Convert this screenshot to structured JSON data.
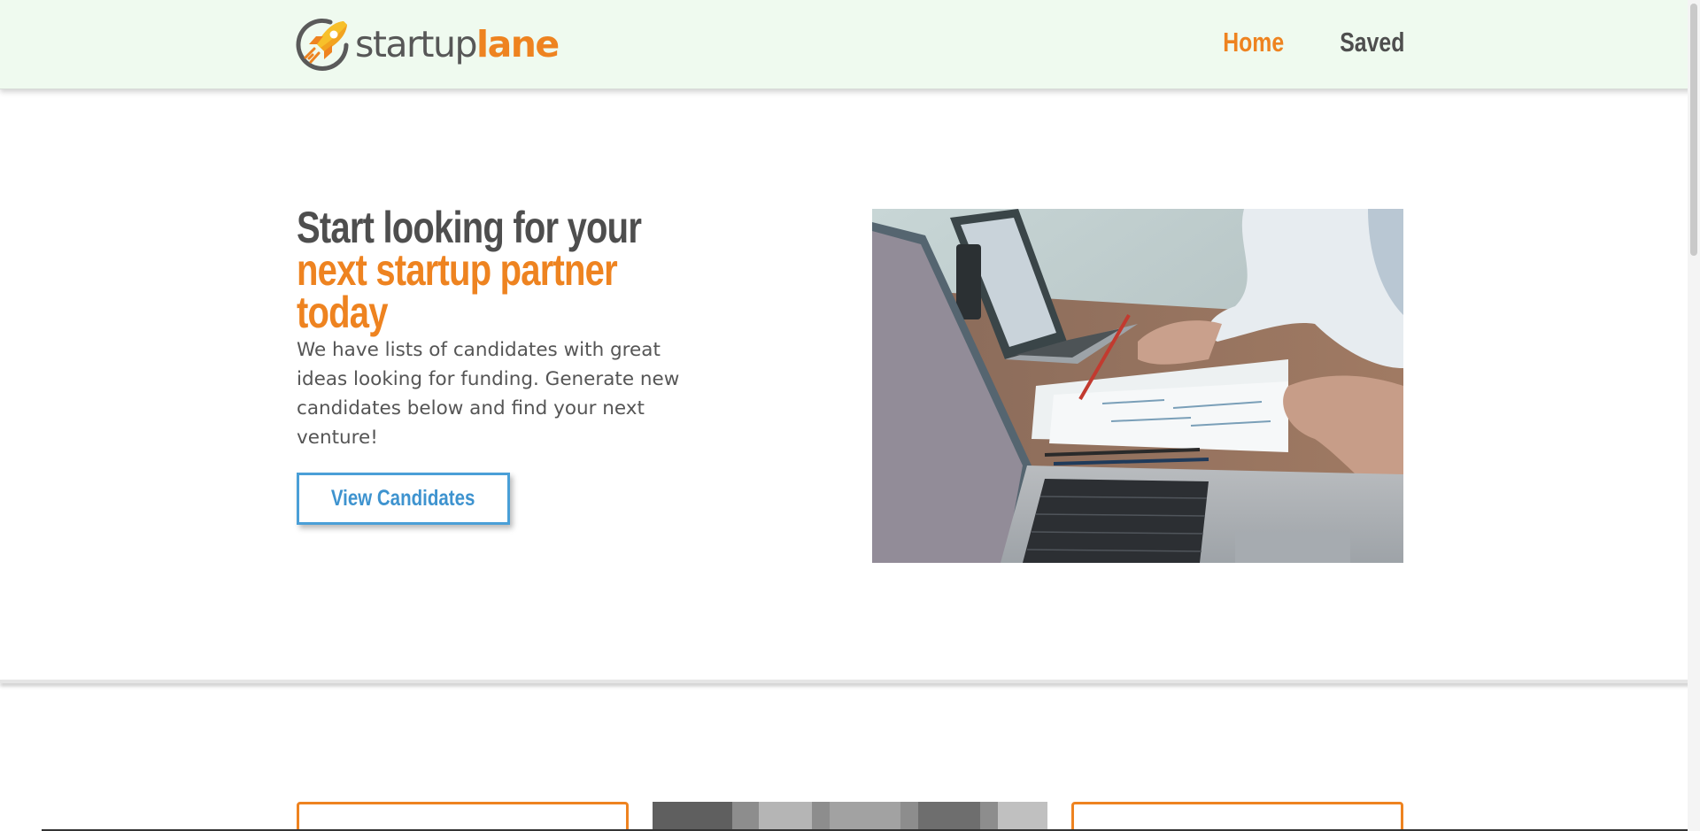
{
  "brand": {
    "name_part1": "startup",
    "name_part2": "lane",
    "primary_color": "#ee8320",
    "text_color": "#575757",
    "icon": "rocket-icon"
  },
  "nav": {
    "items": [
      {
        "label": "Home",
        "active": true
      },
      {
        "label": "Saved",
        "active": false
      }
    ],
    "background": "#effaef"
  },
  "hero": {
    "title_plain": "Start looking for your ",
    "title_accent": "next startup partner today",
    "description": "We have lists of candidates with great ideas looking for funding. Generate new candidates below and find your next venture!",
    "cta_label": "View Candidates",
    "cta_color": "#4a9fd7",
    "image": "laptops-meeting-photo"
  },
  "cards_section": {
    "cards": [
      "orange-bordered-card",
      "city-photo-card",
      "orange-bordered-card"
    ]
  }
}
